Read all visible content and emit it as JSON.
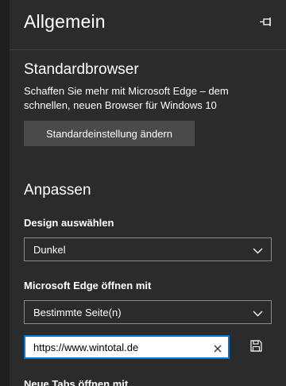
{
  "header": {
    "title": "Allgemein",
    "pin_icon": "pin-icon"
  },
  "default_browser": {
    "heading": "Standardbrowser",
    "description": "Schaffen Sie mehr mit Microsoft Edge – dem schnellen, neuen Browser für Windows 10",
    "button_label": "Standardeinstellung ändern"
  },
  "customize": {
    "heading": "Anpassen",
    "design_label": "Design auswählen",
    "design_value": "Dunkel",
    "open_with_label": "Microsoft Edge öffnen mit",
    "open_with_value": "Bestimmte Seite(n)",
    "url_value": "https://www.wintotal.de",
    "clear_icon": "close-icon",
    "save_icon": "save-icon",
    "new_tabs_label": "Neue Tabs öffnen mit"
  },
  "colors": {
    "background": "#2b2b2b",
    "accent": "#0078d7",
    "button": "#4a4a4a"
  }
}
